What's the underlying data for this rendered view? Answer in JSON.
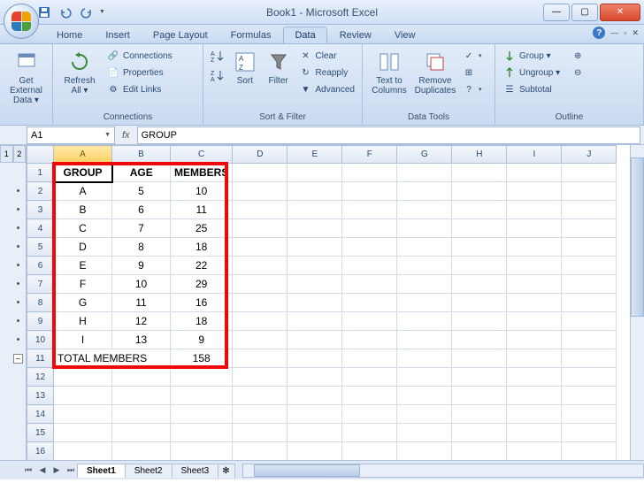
{
  "window": {
    "title": "Book1 - Microsoft Excel"
  },
  "tabs": {
    "home": "Home",
    "insert": "Insert",
    "page_layout": "Page Layout",
    "formulas": "Formulas",
    "data": "Data",
    "review": "Review",
    "view": "View"
  },
  "ribbon": {
    "get_external": "Get External Data ▾",
    "refresh_all": "Refresh All ▾",
    "connections": "Connections",
    "properties": "Properties",
    "edit_links": "Edit Links",
    "connections_group": "Connections",
    "sort": "Sort",
    "filter": "Filter",
    "clear": "Clear",
    "reapply": "Reapply",
    "advanced": "Advanced",
    "sort_filter_group": "Sort & Filter",
    "text_to_columns": "Text to Columns",
    "remove_duplicates": "Remove Duplicates",
    "data_tools_group": "Data Tools",
    "group": "Group ▾",
    "ungroup": "Ungroup ▾",
    "subtotal": "Subtotal",
    "outline_group": "Outline"
  },
  "formula_bar": {
    "name_box": "A1",
    "fx": "fx",
    "formula": "GROUP"
  },
  "outline_levels": [
    "1",
    "2"
  ],
  "columns": [
    "A",
    "B",
    "C",
    "D",
    "E",
    "F",
    "G",
    "H",
    "I",
    "J"
  ],
  "row_numbers": [
    "1",
    "2",
    "3",
    "4",
    "5",
    "6",
    "7",
    "8",
    "9",
    "10",
    "11",
    "12",
    "13",
    "14",
    "15",
    "16"
  ],
  "headers": {
    "c0": "GROUP",
    "c1": "AGE",
    "c2": "MEMBERS"
  },
  "rows": [
    {
      "c0": "A",
      "c1": "5",
      "c2": "10"
    },
    {
      "c0": "B",
      "c1": "6",
      "c2": "11"
    },
    {
      "c0": "C",
      "c1": "7",
      "c2": "25"
    },
    {
      "c0": "D",
      "c1": "8",
      "c2": "18"
    },
    {
      "c0": "E",
      "c1": "9",
      "c2": "22"
    },
    {
      "c0": "F",
      "c1": "10",
      "c2": "29"
    },
    {
      "c0": "G",
      "c1": "11",
      "c2": "16"
    },
    {
      "c0": "H",
      "c1": "12",
      "c2": "18"
    },
    {
      "c0": "I",
      "c1": "13",
      "c2": "9"
    }
  ],
  "total": {
    "label": "TOTAL MEMBERS",
    "value": "158"
  },
  "sheets": {
    "s1": "Sheet1",
    "s2": "Sheet2",
    "s3": "Sheet3"
  },
  "chart_data": {
    "type": "table",
    "title": "",
    "columns": [
      "GROUP",
      "AGE",
      "MEMBERS"
    ],
    "rows": [
      [
        "A",
        5,
        10
      ],
      [
        "B",
        6,
        11
      ],
      [
        "C",
        7,
        25
      ],
      [
        "D",
        8,
        18
      ],
      [
        "E",
        9,
        22
      ],
      [
        "F",
        10,
        29
      ],
      [
        "G",
        11,
        16
      ],
      [
        "H",
        12,
        18
      ],
      [
        "I",
        13,
        9
      ]
    ],
    "total_members": 158
  }
}
